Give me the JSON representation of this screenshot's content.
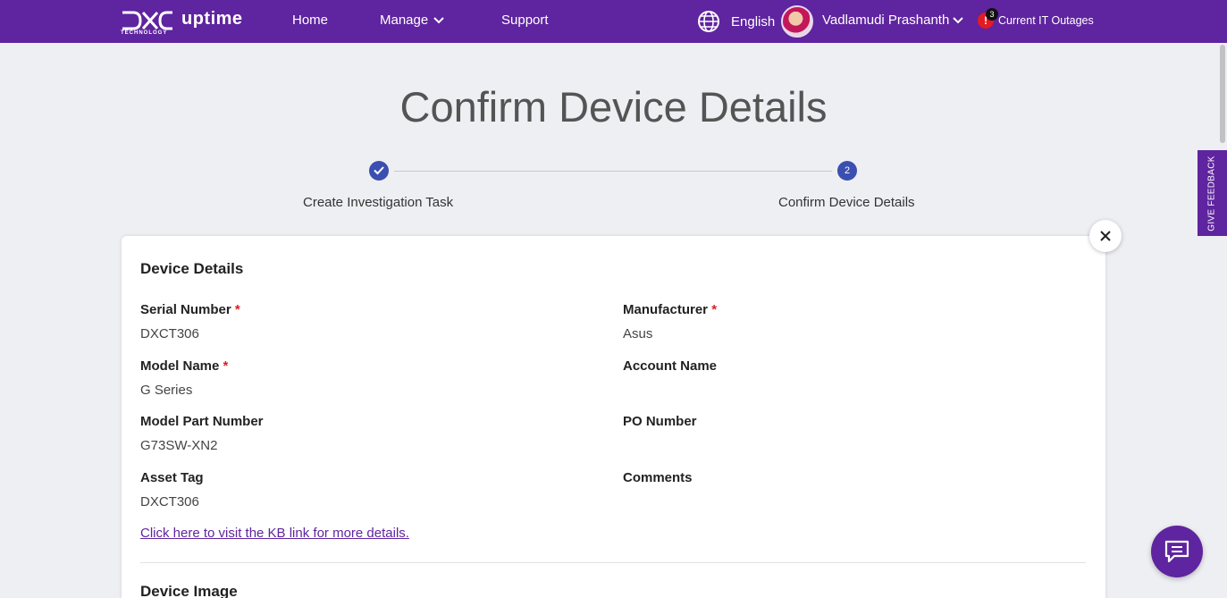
{
  "header": {
    "logo_sub": "TECHNOLOGY",
    "app_name": "uptime",
    "nav": [
      {
        "label": "Home"
      },
      {
        "label": "Manage"
      },
      {
        "label": "Support"
      }
    ],
    "language": "English",
    "user_name": "Vadlamudi Prashanth",
    "alert_count": "3",
    "alert_symbol": "!",
    "outages_label": "Current IT Outages"
  },
  "feedback_label": "GIVE FEEDBACK",
  "page_title": "Confirm Device Details",
  "stepper": {
    "steps": [
      {
        "label": "Create Investigation Task",
        "state": "completed"
      },
      {
        "label": "Confirm Device Details",
        "number": "2",
        "state": "active"
      }
    ]
  },
  "card": {
    "section_title": "Device Details",
    "fields": {
      "serial_number": {
        "label": "Serial Number",
        "required": "*",
        "value": "DXCT306"
      },
      "manufacturer": {
        "label": "Manufacturer",
        "required": "*",
        "value": "Asus"
      },
      "model_name": {
        "label": "Model Name",
        "required": "*",
        "value": "G Series"
      },
      "account_name": {
        "label": "Account Name",
        "value": ""
      },
      "model_part_number": {
        "label": "Model Part Number",
        "value": "G73SW-XN2"
      },
      "po_number": {
        "label": "PO Number",
        "value": ""
      },
      "asset_tag": {
        "label": "Asset Tag",
        "value": "DXCT306"
      },
      "comments": {
        "label": "Comments",
        "value": ""
      }
    },
    "kb_link": "Click here to visit the KB link for more details.",
    "image_section_title": "Device Image"
  },
  "colors": {
    "brand": "#5f249f",
    "stepper": "#3b4fb0",
    "required": "#e31b23"
  }
}
